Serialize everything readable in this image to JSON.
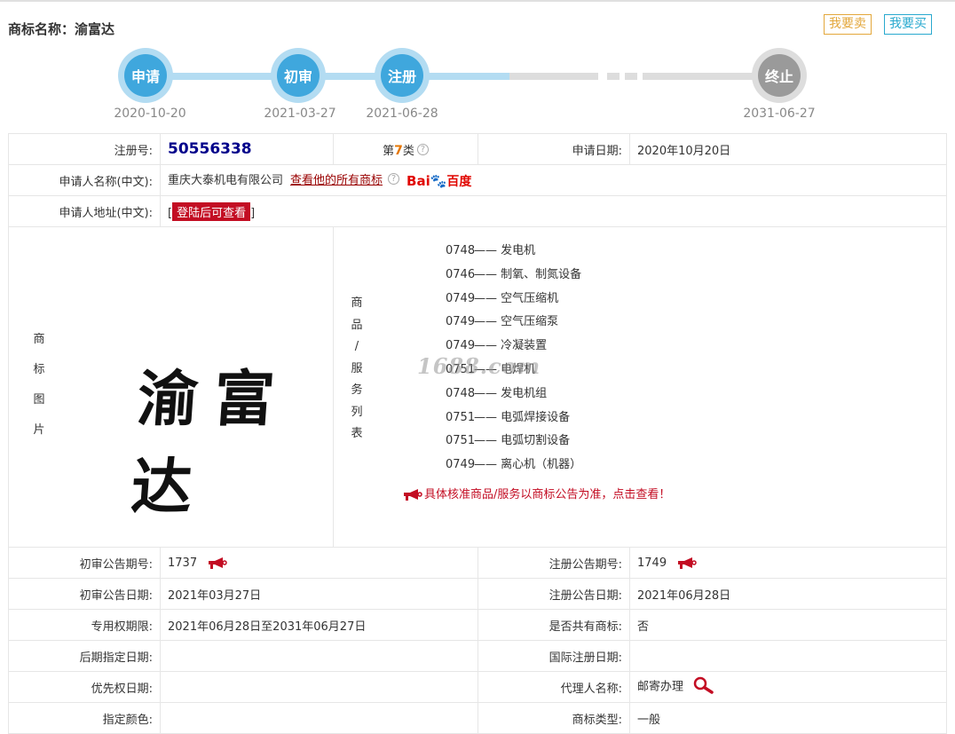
{
  "header": {
    "title_label": "商标名称：",
    "title_value": "渝富达",
    "sell_label": "我要卖",
    "buy_label": "我要买"
  },
  "timeline": [
    {
      "label": "申请",
      "date": "2020-10-20"
    },
    {
      "label": "初审",
      "date": "2021-03-27"
    },
    {
      "label": "注册",
      "date": "2021-06-28"
    },
    {
      "label": "终止",
      "date": "2031-06-27"
    }
  ],
  "info": {
    "reg_no_label": "注册号:",
    "reg_no": "50556338",
    "class_prefix": "第",
    "class_num": "7",
    "class_suffix": "类",
    "help_glyph": "?",
    "apply_date_label": "申请日期:",
    "apply_date": "2020年10月20日",
    "applicant_label": "申请人名称(中文):",
    "applicant": "重庆大泰机电有限公司",
    "view_all_link": "查看他的所有商标",
    "baidu_b1": "Bai",
    "baidu_paw": "🐾",
    "baidu_b2": "百度",
    "address_label": "申请人地址(中文):",
    "bracket_left": "[",
    "login_btn": "登陆后可查看",
    "bracket_right": "]",
    "image_label_chars": [
      "商",
      "标",
      "图",
      "片"
    ],
    "trademark_text": "渝富达",
    "goods_label_chars": [
      "商",
      "品",
      "/",
      "服",
      "务",
      "列",
      "表"
    ],
    "goods": [
      {
        "code": "0748",
        "sep": "——",
        "name": "发电机"
      },
      {
        "code": "0746",
        "sep": "——",
        "name": "制氧、制氮设备"
      },
      {
        "code": "0749",
        "sep": "——",
        "name": "空气压缩机"
      },
      {
        "code": "0749",
        "sep": "——",
        "name": "空气压缩泵"
      },
      {
        "code": "0749",
        "sep": "——",
        "name": "冷凝装置"
      },
      {
        "code": "0751",
        "sep": "——",
        "name": "电焊机"
      },
      {
        "code": "0748",
        "sep": "——",
        "name": "发电机组"
      },
      {
        "code": "0751",
        "sep": "——",
        "name": "电弧焊接设备"
      },
      {
        "code": "0751",
        "sep": "——",
        "name": "电弧切割设备"
      },
      {
        "code": "0749",
        "sep": "——",
        "name": "离心机（机器）"
      }
    ],
    "goods_notice": "具体核准商品/服务以商标公告为准，点击查看！",
    "prelim_no_label": "初审公告期号:",
    "prelim_no": "1737",
    "reg_notice_no_label": "注册公告期号:",
    "reg_notice_no": "1749",
    "prelim_date_label": "初审公告日期:",
    "prelim_date": "2021年03月27日",
    "reg_notice_date_label": "注册公告日期:",
    "reg_notice_date": "2021年06月28日",
    "exclusive_label": "专用权期限:",
    "exclusive": "2021年06月28日至2031年06月27日",
    "shared_label": "是否共有商标:",
    "shared": "否",
    "later_date_label": "后期指定日期:",
    "later_date": "",
    "intl_date_label": "国际注册日期:",
    "intl_date": "",
    "priority_label": "优先权日期:",
    "priority": "",
    "agent_label": "代理人名称:",
    "agent": "邮寄办理",
    "color_label": "指定颜色:",
    "color": "",
    "type_label": "商标类型:",
    "type": "一般"
  },
  "watermark": "1688.com",
  "colors": {
    "step_active": "#3fa7dd",
    "step_inactive": "#9a9a9a",
    "reg_no": "#00008b",
    "class_num": "#e57600",
    "alert_red": "#c30d23"
  }
}
